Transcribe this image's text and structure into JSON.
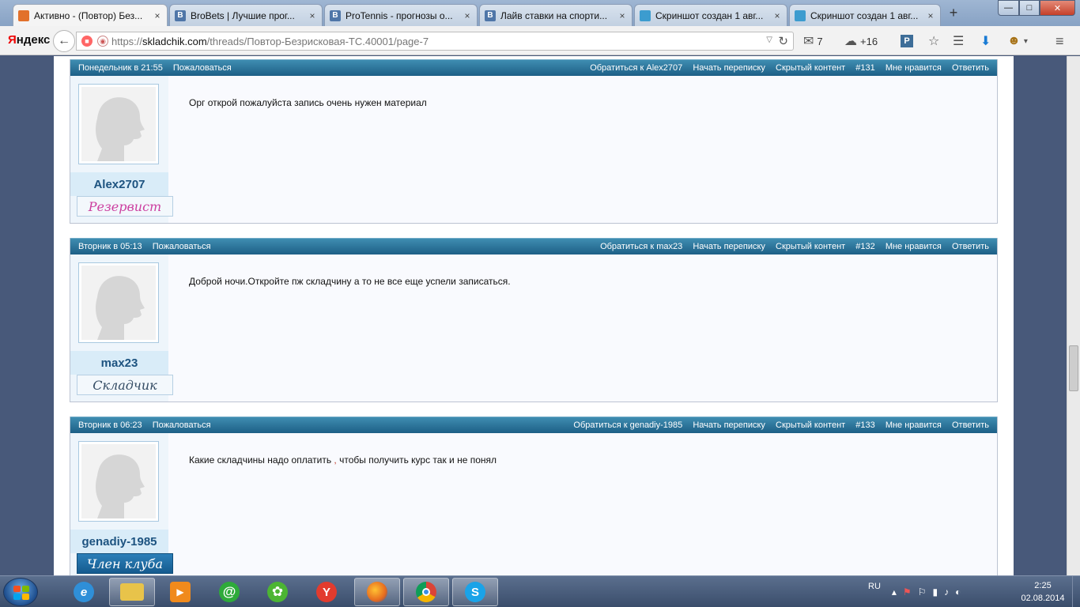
{
  "browser": {
    "tabs": [
      {
        "title": "Активно - (Повтор) Без...",
        "favicon_color": "#e2712b",
        "favicon_glyph": "",
        "active": true
      },
      {
        "title": "BroBets | Лучшие прог...",
        "favicon_color": "#4f76a8",
        "favicon_glyph": "B",
        "active": false
      },
      {
        "title": "ProTennis - прогнозы о...",
        "favicon_color": "#4f76a8",
        "favicon_glyph": "B",
        "active": false
      },
      {
        "title": "Лайв ставки на спорти...",
        "favicon_color": "#4f76a8",
        "favicon_glyph": "B",
        "active": false
      },
      {
        "title": "Скриншот создан 1 авг...",
        "favicon_color": "#3c9ccf",
        "favicon_glyph": "",
        "active": false
      },
      {
        "title": "Скриншот создан 1 авг...",
        "favicon_color": "#3c9ccf",
        "favicon_glyph": "",
        "active": false
      }
    ],
    "newtab_label": "+",
    "close_glyph": "×",
    "window_controls": {
      "minimize": "—",
      "maximize": "□",
      "close": "✕"
    }
  },
  "toolbar": {
    "logo_first": "Я",
    "logo_rest": "ндекс",
    "back_glyph": "←",
    "url_prefix": "https://",
    "url_domain": "skladchik.com",
    "url_path": "/threads/Повтор-Безрисковая-ТС.40001/page-7",
    "mail_count": "7",
    "weather": "+16",
    "pin_label": "P"
  },
  "posts": [
    {
      "date": "Понедельник в 21:55",
      "report": "Пожаловаться",
      "contact": "Обратиться к Alex2707",
      "start_conversation": "Начать переписку",
      "hidden_content": "Скрытый контент",
      "number": "#131",
      "like": "Мне нравится",
      "reply": "Ответить",
      "username": "Alex2707",
      "rank": "Резервист",
      "rank_style": "pink",
      "message": "Орг открой пожалуйста запись очень нужен материал",
      "message_comma": "",
      "message_tail": ""
    },
    {
      "date": "Вторник в 05:13",
      "report": "Пожаловаться",
      "contact": "Обратиться к max23",
      "start_conversation": "Начать переписку",
      "hidden_content": "Скрытый контент",
      "number": "#132",
      "like": "Мне нравится",
      "reply": "Ответить",
      "username": "max23",
      "rank": "Складчик",
      "rank_style": "gray",
      "message": "Доброй ночи.Откройте пж складчину а то не все еще успели записаться.",
      "message_comma": "",
      "message_tail": ""
    },
    {
      "date": "Вторник в 06:23",
      "report": "Пожаловаться",
      "contact": "Обратиться к genadiy-1985",
      "start_conversation": "Начать переписку",
      "hidden_content": "Скрытый контент",
      "number": "#133",
      "like": "Мне нравится",
      "reply": "Ответить",
      "username": "genadiy-1985",
      "rank": "Член клуба",
      "rank_style": "blue",
      "message": "Какие складчины надо оплатить ",
      "message_comma": ",",
      "message_tail": " чтобы получить курс так и не понял"
    }
  ],
  "taskbar": {
    "apps": [
      {
        "name": "internet-explorer",
        "glyph": "e",
        "color": "#2f8fd8",
        "active": false
      },
      {
        "name": "file-explorer",
        "glyph": "",
        "color": "#e8c34a",
        "active": true
      },
      {
        "name": "media-player",
        "glyph": "▶",
        "color": "#f08a1c",
        "active": false
      },
      {
        "name": "mail-agent",
        "glyph": "@",
        "color": "#2eaa3a",
        "active": false
      },
      {
        "name": "icq",
        "glyph": "✿",
        "color": "#4cb533",
        "active": false
      },
      {
        "name": "yandex-browser",
        "glyph": "Y",
        "color": "#e23b2e",
        "active": false
      },
      {
        "name": "firefox",
        "glyph": "",
        "color": "#e66b1f",
        "active": true
      },
      {
        "name": "chrome",
        "glyph": "",
        "color": "#3a8ee6",
        "active": true
      },
      {
        "name": "skype",
        "glyph": "S",
        "color": "#1aa3e8",
        "active": true
      }
    ],
    "language": "RU",
    "time": "2:25",
    "date": "02.08.2014"
  }
}
